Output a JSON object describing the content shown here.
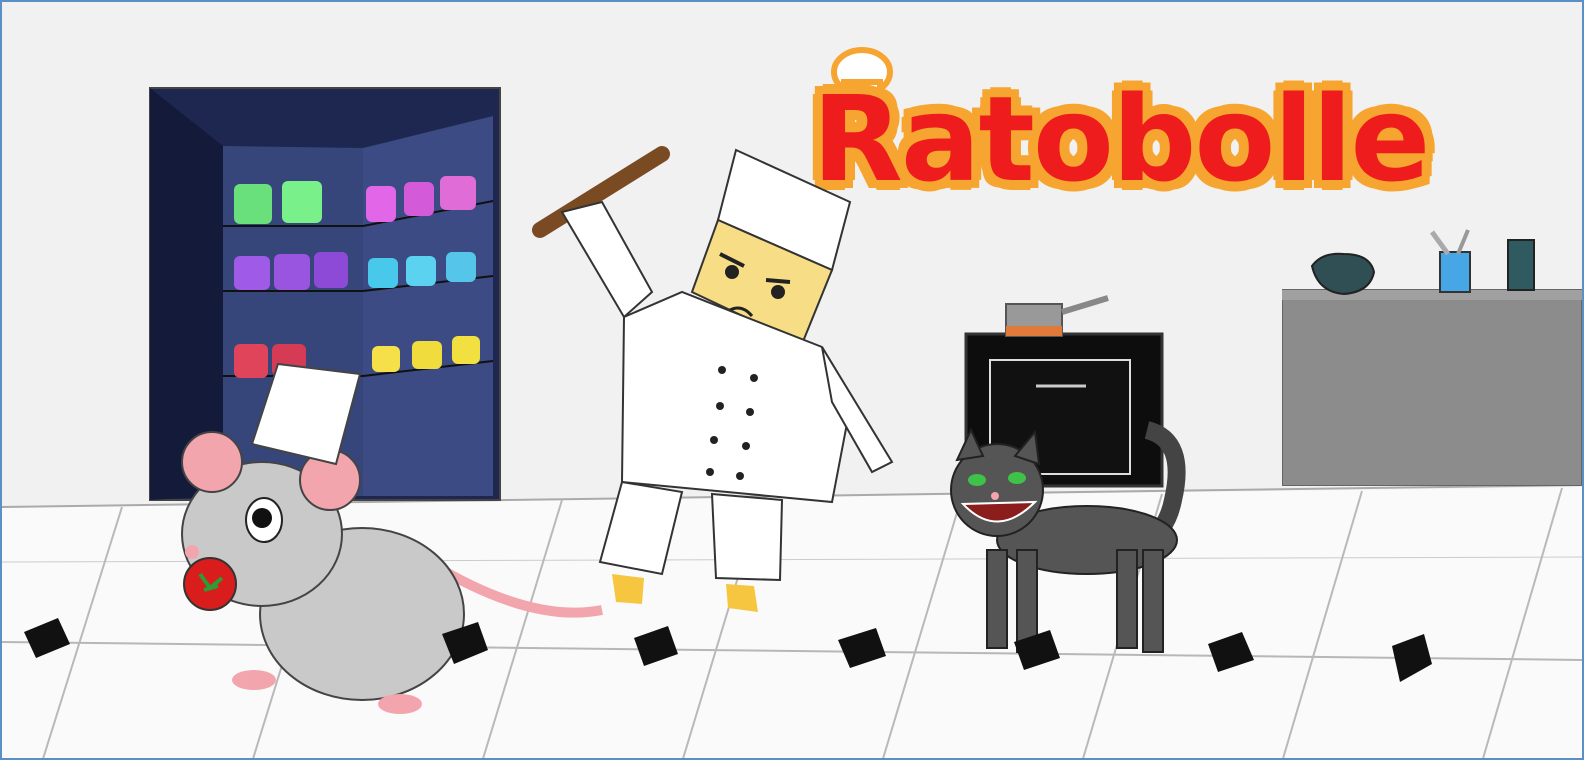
{
  "game": {
    "title_logo": "Ratobolle"
  },
  "palette": {
    "wall": "#f2f2f2",
    "floor": "#fbfbfb",
    "floor_lines": "#b9b9b9",
    "fridge_dark": "#1f2a55",
    "fridge_inner": "#3e4d86",
    "logo_red": "#ee1c1c",
    "logo_orange": "#f7a531",
    "counter_grey": "#8c8c8c",
    "oven_black": "#0d0d0d",
    "mouse_grey": "#c9c9c9",
    "cat_grey": "#555555",
    "chef_white": "#ffffff",
    "chef_skin": "#f7de86"
  },
  "sprites": {
    "player": "mouse-chef-icon",
    "enemy_chef": "angry-chef-icon",
    "enemy_cat": "grinning-cat-icon",
    "held_item": "tomato-icon",
    "weapon": "rolling-pin-icon",
    "fridge": "open-fridge-icon",
    "oven": "oven-icon",
    "pot": "saucepan-icon",
    "counter": "kitchen-counter-icon"
  }
}
